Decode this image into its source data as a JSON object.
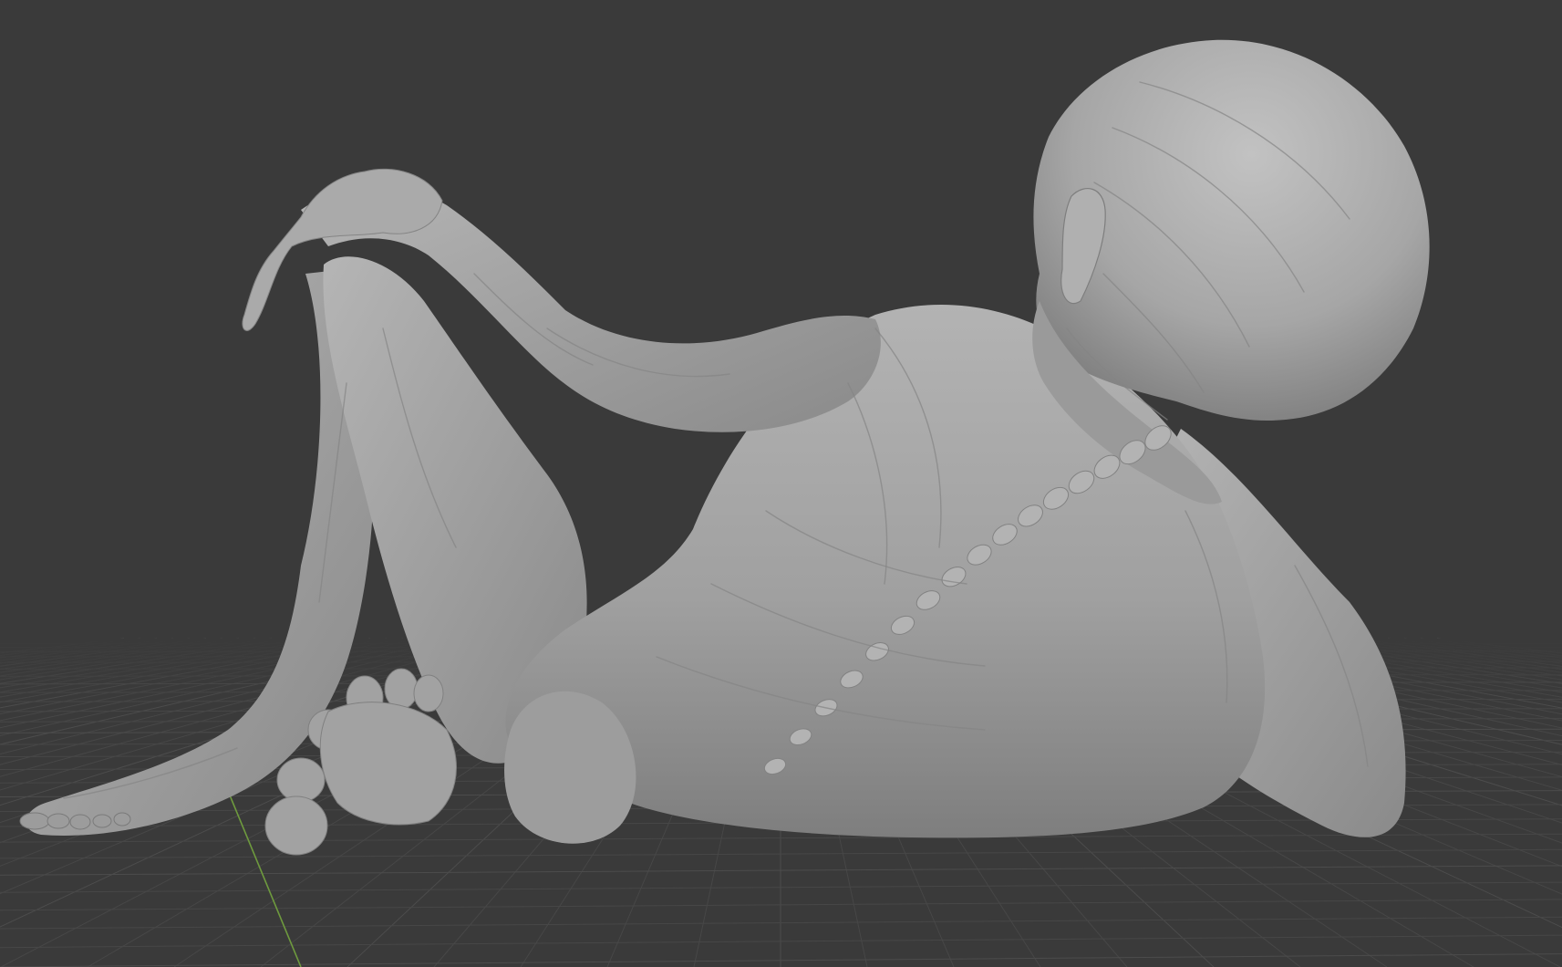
{
  "viewport": {
    "background_color": "#3a3a3a",
    "grid_color": "#474747",
    "grid_major_color": "#4c4c4c",
    "y_axis_color": "#6e9a3e",
    "model_color": "#a5a5a5",
    "model_highlight_color": "#bdbdbd",
    "model_shadow_color": "#767676",
    "model_name": "sculpted-creature",
    "shading_mode": "solid"
  }
}
